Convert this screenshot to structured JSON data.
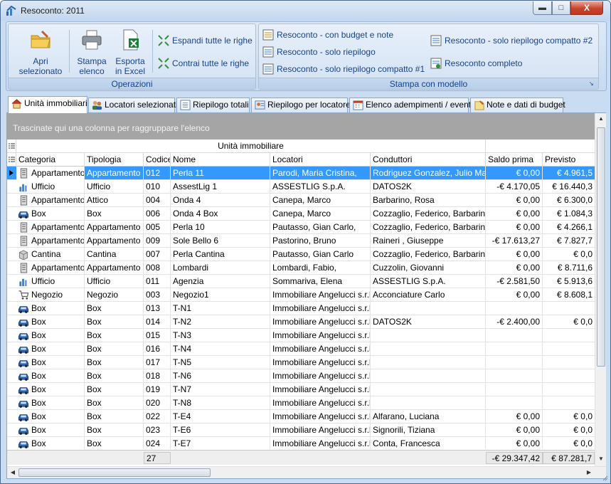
{
  "window": {
    "title": "Resoconto: 2011",
    "min_label": "▬",
    "max_label": "□",
    "close_label": "X"
  },
  "ribbon": {
    "groups": [
      {
        "label": "Operazioni"
      },
      {
        "label": "Stampa con modello"
      }
    ],
    "operazioni": {
      "apri": "Apri\nselezionato",
      "stampa": "Stampa\nelenco",
      "esporta": "Esporta\nin Excel",
      "espandi": "Espandi tutte le righe",
      "contrai": "Contrai tutte le righe"
    },
    "stampa": {
      "budget_note": "Resoconto - con budget e note",
      "solo_riepilogo": "Resoconto - solo riepilogo",
      "compatto1": "Resoconto - solo riepilogo compatto #1",
      "compatto2": "Resoconto - solo riepilogo compatto #2",
      "completo": "Resoconto completo"
    }
  },
  "tabs": [
    {
      "label": "Unità immobiliari",
      "icon": "house-icon",
      "active": true
    },
    {
      "label": "Locatori selezionati",
      "icon": "people-icon",
      "active": false
    },
    {
      "label": "Riepilogo totali",
      "icon": "list-icon",
      "active": false
    },
    {
      "label": "Riepilogo per locatore",
      "icon": "person-card-icon",
      "active": false
    },
    {
      "label": "Elenco adempimenti / eventi",
      "icon": "calendar-icon",
      "active": false
    },
    {
      "label": "Note e dati di budget",
      "icon": "note-icon",
      "active": false
    }
  ],
  "grid": {
    "group_panel_text": "Trascinate qui una colonna per raggruppare l'elenco",
    "band_label": "Unità immobiliare",
    "columns": [
      "Categoria",
      "Tipologia",
      "Codice",
      "Nome",
      "Locatori",
      "Conduttori",
      "Saldo prima",
      "Previsto"
    ],
    "rows": [
      [
        "Appartamento",
        "Appartamento",
        "012",
        "Perla 11",
        "Parodi, Maria Cristina,",
        "Rodriguez Gonzalez, Julio Mario,",
        "€ 0,00",
        "€ 4.961,5"
      ],
      [
        "Ufficio",
        "Ufficio",
        "010",
        "AssestLig 1",
        "ASSESTLIG S.p.A.",
        "DATOS2K",
        "-€ 4.170,05",
        "€ 16.440,3"
      ],
      [
        "Appartamento",
        "Attico",
        "004",
        "Onda 4",
        "Canepa, Marco",
        "Barbarino, Rosa",
        "€ 0,00",
        "€ 6.300,0"
      ],
      [
        "Box",
        "Box",
        "006",
        "Onda 4 Box",
        "Canepa, Marco",
        "Cozzaglio, Federico, Barbarino,",
        "€ 0,00",
        "€ 1.084,3"
      ],
      [
        "Appartamento",
        "Appartamento",
        "005",
        "Perla 10",
        "Pautasso, Gian Carlo,",
        "Cozzaglio, Federico, Barbarino,",
        "€ 0,00",
        "€ 4.266,1"
      ],
      [
        "Appartamento",
        "Appartamento",
        "009",
        "Sole Bello 6",
        "Pastorino, Bruno",
        "Raineri , Giuseppe",
        "-€ 17.613,27",
        "€ 7.827,7"
      ],
      [
        "Cantina",
        "Cantina",
        "007",
        "Perla Cantina",
        "Pautasso, Gian Carlo",
        "Cozzaglio, Federico, Barbarino,",
        "€ 0,00",
        "€ 0,0"
      ],
      [
        "Appartamento",
        "Appartamento",
        "008",
        "Lombardi",
        "Lombardi, Fabio,",
        "Cuzzolin, Giovanni",
        "€ 0,00",
        "€ 8.711,6"
      ],
      [
        "Ufficio",
        "Ufficio",
        "011",
        "Agenzia",
        "Sommariva, Elena",
        "ASSESTLIG S.p.A.",
        "-€ 2.581,50",
        "€ 5.913,6"
      ],
      [
        "Negozio",
        "Negozio",
        "003",
        "Negozio1",
        "Immobiliare Angelucci s.r.l.",
        "Acconciature Carlo",
        "€ 0,00",
        "€ 8.608,1"
      ],
      [
        "Box",
        "Box",
        "013",
        "T-N1",
        "Immobiliare Angelucci s.r.l.",
        "",
        "",
        ""
      ],
      [
        "Box",
        "Box",
        "014",
        "T-N2",
        "Immobiliare Angelucci s.r.l.",
        "DATOS2K",
        "-€ 2.400,00",
        "€ 0,0"
      ],
      [
        "Box",
        "Box",
        "015",
        "T-N3",
        "Immobiliare Angelucci s.r.l.",
        "",
        "",
        ""
      ],
      [
        "Box",
        "Box",
        "016",
        "T-N4",
        "Immobiliare Angelucci s.r.l.",
        "",
        "",
        ""
      ],
      [
        "Box",
        "Box",
        "017",
        "T-N5",
        "Immobiliare Angelucci s.r.l.",
        "",
        "",
        ""
      ],
      [
        "Box",
        "Box",
        "018",
        "T-N6",
        "Immobiliare Angelucci s.r.l.",
        "",
        "",
        ""
      ],
      [
        "Box",
        "Box",
        "019",
        "T-N7",
        "Immobiliare Angelucci s.r.l.",
        "",
        "",
        ""
      ],
      [
        "Box",
        "Box",
        "020",
        "T-N8",
        "Immobiliare Angelucci s.r.l.",
        "",
        "",
        ""
      ],
      [
        "Box",
        "Box",
        "022",
        "T-E4",
        "Immobiliare Angelucci s.r.l.",
        "Alfarano, Luciana",
        "€ 0,00",
        "€ 0,0"
      ],
      [
        "Box",
        "Box",
        "023",
        "T-E6",
        "Immobiliare Angelucci s.r.l.",
        "Signorili, Tiziana",
        "€ 0,00",
        "€ 0,0"
      ],
      [
        "Box",
        "Box",
        "024",
        "T-E7",
        "Immobiliare Angelucci s.r.l.",
        "Conta, Francesca",
        "€ 0,00",
        "€ 0,0"
      ]
    ],
    "selected_row": 0,
    "footer": {
      "count": "27",
      "saldo_prima": "-€ 29.347,42",
      "previsto": "€ 87.281,7"
    }
  },
  "colors": {
    "selection": "#3399ff",
    "ribbon_text": "#15428b",
    "group_panel": "#a5a5a5"
  }
}
